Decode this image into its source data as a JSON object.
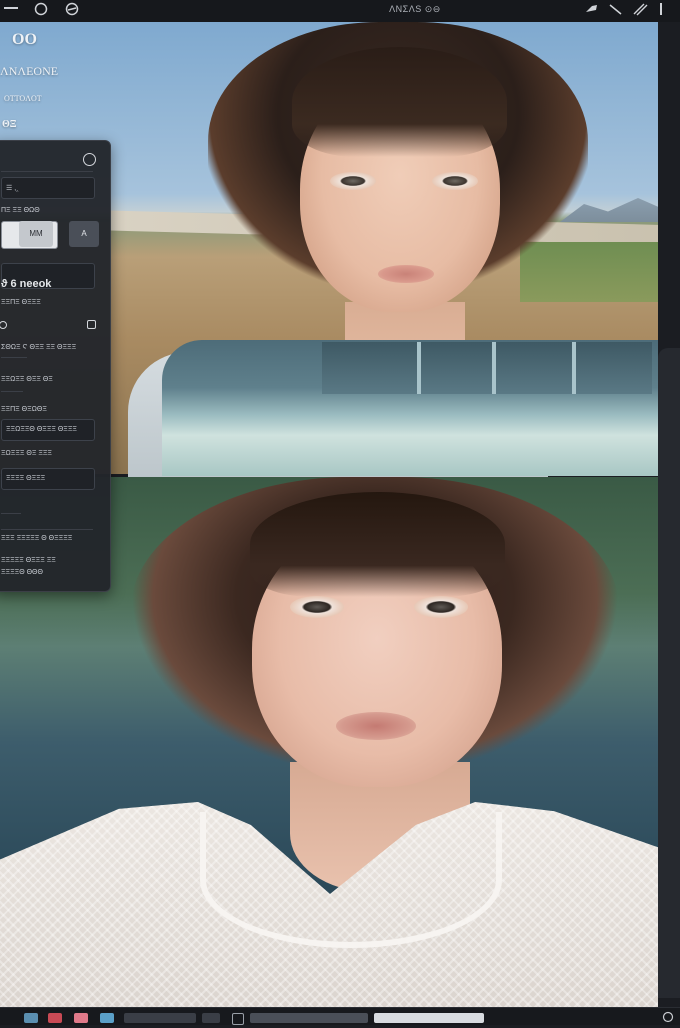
{
  "app": {
    "title": "ΛNΣΛS ⊙⊖"
  },
  "topbar": {
    "menu_icon": "hamburger-icon",
    "tools": [
      "circle-tool-icon",
      "stamp-icon",
      "brush-icon",
      "pen-icon",
      "line-icon"
    ]
  },
  "overlay": {
    "line1": "OO",
    "line2": "ΛNΛEONE",
    "line3": "OTTOΛOT",
    "line4": "ΘΞ"
  },
  "panel": {
    "row1": "",
    "row2": "☰ ,‸",
    "row3": "ΠΞ ΞΞ ΘΩΘ",
    "btn_mm": "MM",
    "btn_a": "A",
    "heading": "ϑ 6 neeok",
    "row4": "ΞΞΠΞ ΘΞΞΞ",
    "row5": "ΣΘΩΞ Ϛ ΘΞΞ ΞΞ ΘΞΞΞ",
    "row6": "ΞΞΩΞΞ ΘΞΞ ΘΞ",
    "row7": "ΞΞΠΞ ΘΞΩΘΞ",
    "row8": "ΞΞΩΞΞΘ ΘΞΞΞ ΘΞΞΞ",
    "row9": "ΞΩΞΞΞ ΘΞ ΞΞΞ",
    "row10": "ΞΞΞΞ ΘΞΞΞ",
    "row11": "ΞΞΞ ΞΞΞΞΞ Θ ΘΞΞΞΞ",
    "row12": "ΞΞΞΞΞ ΘΞΞΞ ΞΞ",
    "row13": "ΞΞΞΞΘ ΘΘΘ"
  },
  "dock": {
    "swatches": [
      "#5b8fb0",
      "#c94a55",
      "#e07a8a",
      "#5ba0c8"
    ],
    "settings_icon": "circle-icon"
  }
}
